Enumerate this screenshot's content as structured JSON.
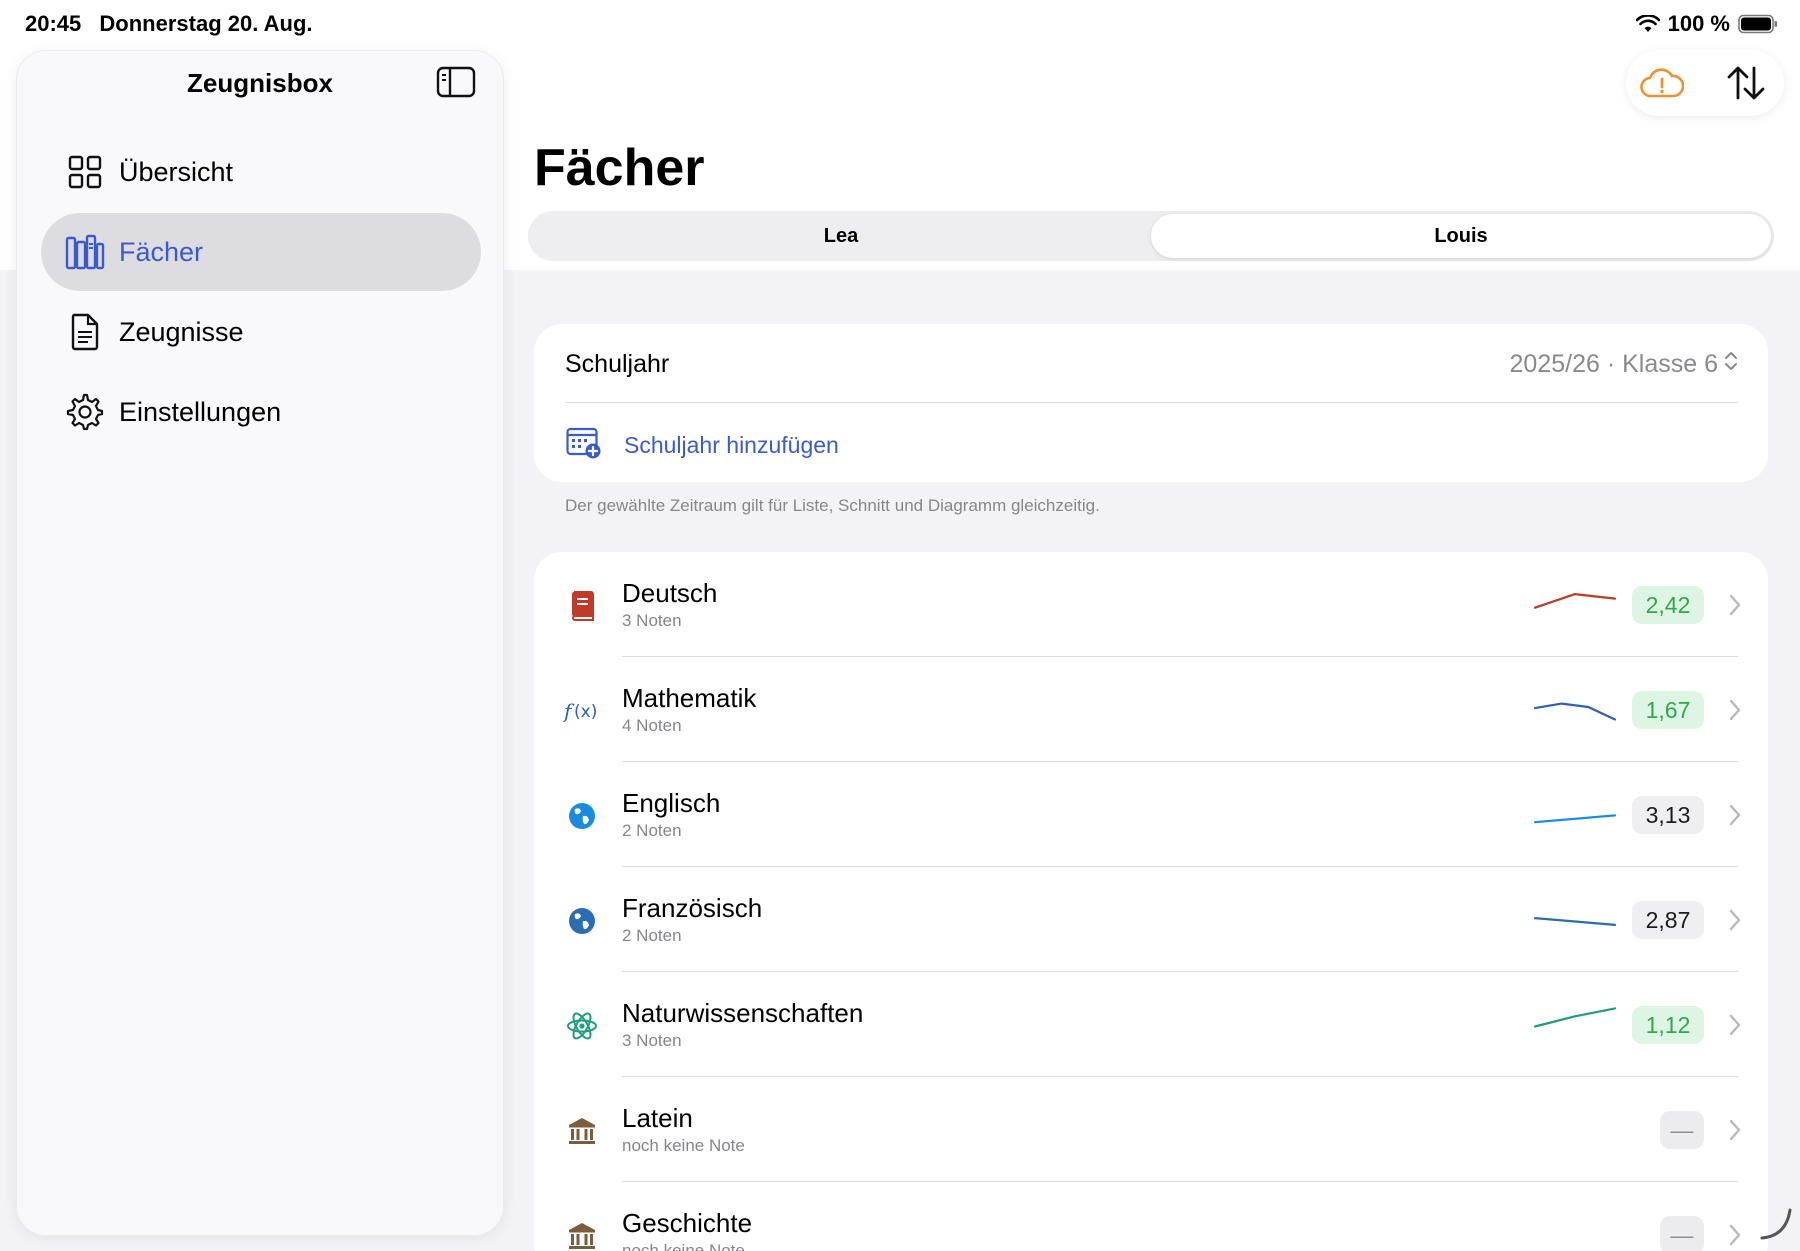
{
  "status": {
    "time": "20:45",
    "date": "Donnerstag 20. Aug.",
    "battery": "100 %"
  },
  "sidebar": {
    "title": "Zeugnisbox",
    "items": [
      {
        "label": "Übersicht",
        "icon": "grid-icon"
      },
      {
        "label": "Fächer",
        "icon": "books-icon",
        "active": true
      },
      {
        "label": "Zeugnisse",
        "icon": "document-icon"
      },
      {
        "label": "Einstellungen",
        "icon": "gear-icon"
      }
    ]
  },
  "main": {
    "title": "Fächer",
    "tabs": [
      {
        "label": "Lea"
      },
      {
        "label": "Louis",
        "selected": true
      }
    ],
    "year": {
      "label": "Schuljahr",
      "value": "2025/26 · Klasse 6",
      "add_label": "Schuljahr hinzufügen",
      "footnote": "Der gewählte Zeitraum gilt für Liste, Schnitt und Diagramm gleichzeitig."
    },
    "subjects": [
      {
        "name": "Deutsch",
        "count": "3 Noten",
        "grade": "2,42",
        "grade_style": "good",
        "trend": [
          3,
          1.8,
          2.2
        ],
        "color": "#c0392b",
        "icon": "book-icon"
      },
      {
        "name": "Mathematik",
        "count": "4 Noten",
        "grade": "1,67",
        "grade_style": "good",
        "trend": [
          2.6,
          2.2,
          2.5,
          3.6
        ],
        "color": "#2e5dc4",
        "icon": "function-icon"
      },
      {
        "name": "Englisch",
        "count": "2 Noten",
        "grade": "3,13",
        "grade_style": "neutral",
        "trend": [
          3.4,
          2.8
        ],
        "color": "#1a8ce0",
        "icon": "globe-icon"
      },
      {
        "name": "Französisch",
        "count": "2 Noten",
        "grade": "2,87",
        "grade_style": "neutral",
        "trend": [
          2.6,
          3.2
        ],
        "color": "#2a6db5",
        "icon": "globe-icon"
      },
      {
        "name": "Naturwissenschaften",
        "count": "3 Noten",
        "grade": "1,12",
        "grade_style": "good",
        "trend": [
          2.9,
          2.0,
          1.3
        ],
        "color": "#1e9e7a",
        "icon": "atom-icon"
      },
      {
        "name": "Latein",
        "count": "noch keine Note",
        "grade": "—",
        "grade_style": "none",
        "trend": [],
        "color": "#7a5c3e",
        "icon": "columns-icon"
      },
      {
        "name": "Geschichte",
        "count": "noch keine Note",
        "grade": "—",
        "grade_style": "none",
        "trend": [],
        "color": "#7a5c3e",
        "icon": "columns-icon"
      }
    ]
  },
  "colors": {
    "accent": "#3a5bd0",
    "warning": "#f0922b",
    "good": "#2fa84f"
  }
}
